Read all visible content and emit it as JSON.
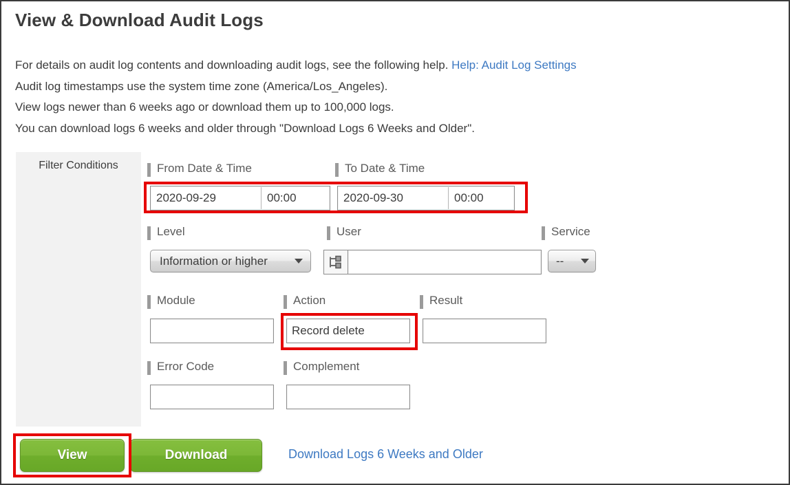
{
  "page": {
    "title": "View & Download Audit Logs"
  },
  "description": {
    "line1_before_link": "For details on audit log contents and downloading audit logs, see the following help. ",
    "help_link": "Help: Audit Log Settings",
    "line2": "Audit log timestamps use the system time zone (America/Los_Angeles).",
    "line3": "View logs newer than 6 weeks ago or download them up to 100,000 logs.",
    "line4": "You can download logs 6 weeks and older through \"Download Logs 6 Weeks and Older\"."
  },
  "filter": {
    "panel_label": "Filter Conditions",
    "from": {
      "label": "From Date & Time",
      "date_value": "2020-09-29",
      "time_value": "00:00",
      "date_placeholder": "",
      "time_placeholder": ""
    },
    "to": {
      "label": "To Date & Time",
      "date_value": "2020-09-30",
      "time_value": "00:00",
      "date_placeholder": "",
      "time_placeholder": ""
    },
    "level": {
      "label": "Level",
      "selected": "Information or higher"
    },
    "user": {
      "label": "User",
      "value": "",
      "placeholder": "",
      "icon": "org-tree-picker-icon"
    },
    "service": {
      "label": "Service",
      "selected": "--"
    },
    "module": {
      "label": "Module",
      "value": "",
      "placeholder": ""
    },
    "action": {
      "label": "Action",
      "value": "Record delete",
      "placeholder": ""
    },
    "result": {
      "label": "Result",
      "value": "",
      "placeholder": ""
    },
    "error_code": {
      "label": "Error Code",
      "value": "",
      "placeholder": ""
    },
    "complement": {
      "label": "Complement",
      "value": "",
      "placeholder": ""
    }
  },
  "actions": {
    "view_label": "View",
    "download_label": "Download",
    "download_older_link": "Download Logs 6 Weeks and Older"
  },
  "colors": {
    "link": "#3d79c2",
    "highlight": "#e60000",
    "button_green": "#7cb737",
    "panel_gray": "#f2f2f2",
    "label_bar": "#9b9b9b"
  }
}
